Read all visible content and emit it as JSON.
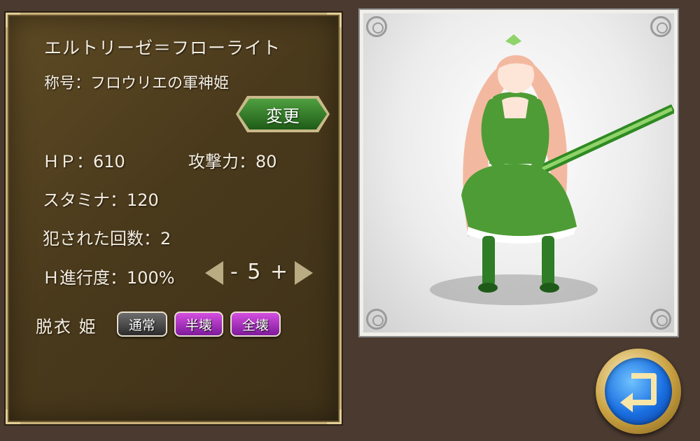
{
  "character": {
    "name": "エルトリーゼ＝フローライト",
    "title": "称号：フロウリエの軍神姫",
    "change_label": "変更"
  },
  "stats": {
    "hp": "ＨＰ：610",
    "attack": "攻撃力：80",
    "stamina": "スタミナ：120",
    "violated_count": "犯された回数：2",
    "h_progress": "Ｈ進行度：100%"
  },
  "level_control": {
    "display": "- 5 +"
  },
  "undress": {
    "label": "脱衣 姫",
    "options": [
      "通常",
      "半壊",
      "全壊"
    ]
  },
  "icons": {
    "left": "arrow-left-icon",
    "right": "arrow-right-icon",
    "back": "return-arrow-icon"
  },
  "colors": {
    "panel_bg": "#4a3a1c",
    "panel_border": "#c9b27a",
    "change_button": "#2f7d26",
    "option_normal": "#3b3b3b",
    "option_selected": "#a42bc0",
    "back_button_blue": "#1a6fe0",
    "back_button_gold": "#c9a040"
  }
}
